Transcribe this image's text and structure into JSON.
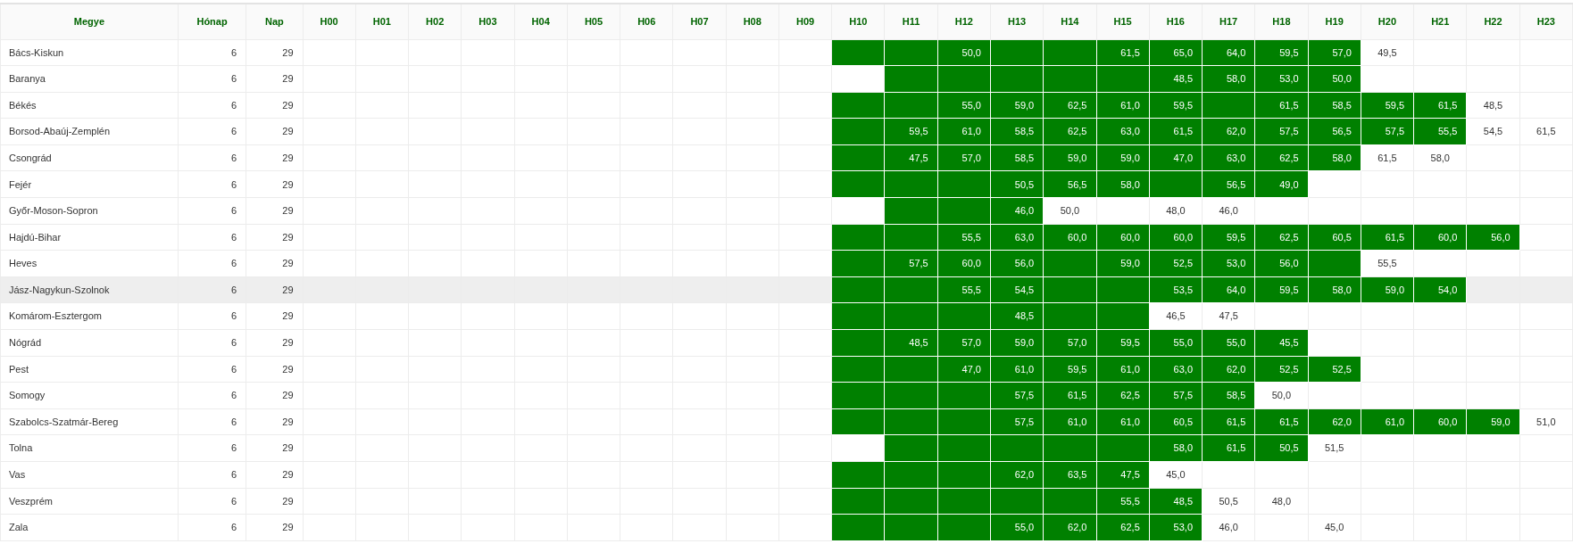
{
  "table": {
    "columns": [
      "Megye",
      "Hónap",
      "Nap",
      "H00",
      "H01",
      "H02",
      "H03",
      "H04",
      "H05",
      "H06",
      "H07",
      "H08",
      "H09",
      "H10",
      "H11",
      "H12",
      "H13",
      "H14",
      "H15",
      "H16",
      "H17",
      "H18",
      "H19",
      "H20",
      "H21",
      "H22",
      "H23"
    ],
    "rows": [
      {
        "county": "Bács-Kiskun",
        "month": "6",
        "day": "29",
        "hovered": false,
        "cells": [
          {
            "highlighted": true
          },
          {
            "highlighted": true
          },
          {
            "value": "50,0",
            "highlighted": true
          },
          {
            "highlighted": true
          },
          {
            "highlighted": true
          },
          {
            "value": "61,5",
            "highlighted": true
          },
          {
            "value": "65,0",
            "highlighted": true
          },
          {
            "value": "64,0",
            "highlighted": true
          },
          {
            "value": "59,5",
            "highlighted": true
          },
          {
            "value": "57,0",
            "highlighted": true
          },
          {
            "value": "49,5",
            "highlighted": false
          },
          {
            "highlighted": false
          },
          {
            "highlighted": false
          },
          {
            "highlighted": false
          }
        ]
      },
      {
        "county": "Baranya",
        "month": "6",
        "day": "29",
        "hovered": false,
        "cells": [
          {
            "highlighted": false
          },
          {
            "highlighted": true
          },
          {
            "highlighted": true
          },
          {
            "highlighted": true
          },
          {
            "highlighted": true
          },
          {
            "highlighted": true
          },
          {
            "value": "48,5",
            "highlighted": true
          },
          {
            "value": "58,0",
            "highlighted": true
          },
          {
            "value": "53,0",
            "highlighted": true
          },
          {
            "value": "50,0",
            "highlighted": true
          },
          {
            "highlighted": false
          },
          {
            "highlighted": false
          },
          {
            "highlighted": false
          },
          {
            "highlighted": false
          }
        ]
      },
      {
        "county": "Békés",
        "month": "6",
        "day": "29",
        "hovered": false,
        "cells": [
          {
            "highlighted": true
          },
          {
            "highlighted": true
          },
          {
            "value": "55,0",
            "highlighted": true
          },
          {
            "value": "59,0",
            "highlighted": true
          },
          {
            "value": "62,5",
            "highlighted": true
          },
          {
            "value": "61,0",
            "highlighted": true
          },
          {
            "value": "59,5",
            "highlighted": true
          },
          {
            "highlighted": true
          },
          {
            "value": "61,5",
            "highlighted": true
          },
          {
            "value": "58,5",
            "highlighted": true
          },
          {
            "value": "59,5",
            "highlighted": true
          },
          {
            "value": "61,5",
            "highlighted": true
          },
          {
            "value": "48,5",
            "highlighted": false
          },
          {
            "highlighted": false
          }
        ]
      },
      {
        "county": "Borsod-Abaúj-Zemplén",
        "month": "6",
        "day": "29",
        "hovered": false,
        "cells": [
          {
            "highlighted": true
          },
          {
            "value": "59,5",
            "highlighted": true
          },
          {
            "value": "61,0",
            "highlighted": true
          },
          {
            "value": "58,5",
            "highlighted": true
          },
          {
            "value": "62,5",
            "highlighted": true
          },
          {
            "value": "63,0",
            "highlighted": true
          },
          {
            "value": "61,5",
            "highlighted": true
          },
          {
            "value": "62,0",
            "highlighted": true
          },
          {
            "value": "57,5",
            "highlighted": true
          },
          {
            "value": "56,5",
            "highlighted": true
          },
          {
            "value": "57,5",
            "highlighted": true
          },
          {
            "value": "55,5",
            "highlighted": true
          },
          {
            "value": "54,5",
            "highlighted": false
          },
          {
            "value": "61,5",
            "highlighted": false
          }
        ]
      },
      {
        "county": "Csongrád",
        "month": "6",
        "day": "29",
        "hovered": false,
        "cells": [
          {
            "highlighted": true
          },
          {
            "value": "47,5",
            "highlighted": true
          },
          {
            "value": "57,0",
            "highlighted": true
          },
          {
            "value": "58,5",
            "highlighted": true
          },
          {
            "value": "59,0",
            "highlighted": true
          },
          {
            "value": "59,0",
            "highlighted": true
          },
          {
            "value": "47,0",
            "highlighted": true
          },
          {
            "value": "63,0",
            "highlighted": true
          },
          {
            "value": "62,5",
            "highlighted": true
          },
          {
            "value": "58,0",
            "highlighted": true
          },
          {
            "value": "61,5",
            "highlighted": false
          },
          {
            "value": "58,0",
            "highlighted": false
          },
          {
            "highlighted": false
          },
          {
            "highlighted": false
          }
        ]
      },
      {
        "county": "Fejér",
        "month": "6",
        "day": "29",
        "hovered": false,
        "cells": [
          {
            "highlighted": true
          },
          {
            "highlighted": true
          },
          {
            "highlighted": true
          },
          {
            "value": "50,5",
            "highlighted": true
          },
          {
            "value": "56,5",
            "highlighted": true
          },
          {
            "value": "58,0",
            "highlighted": true
          },
          {
            "highlighted": true
          },
          {
            "value": "56,5",
            "highlighted": true
          },
          {
            "value": "49,0",
            "highlighted": true
          },
          {
            "highlighted": false
          },
          {
            "highlighted": false
          },
          {
            "highlighted": false
          },
          {
            "highlighted": false
          },
          {
            "highlighted": false
          }
        ]
      },
      {
        "county": "Győr-Moson-Sopron",
        "month": "6",
        "day": "29",
        "hovered": false,
        "cells": [
          {
            "highlighted": false
          },
          {
            "highlighted": true
          },
          {
            "highlighted": true
          },
          {
            "value": "46,0",
            "highlighted": true
          },
          {
            "value": "50,0",
            "highlighted": false
          },
          {
            "highlighted": false
          },
          {
            "value": "48,0",
            "highlighted": false
          },
          {
            "value": "46,0",
            "highlighted": false
          },
          {
            "highlighted": false
          },
          {
            "highlighted": false
          },
          {
            "highlighted": false
          },
          {
            "highlighted": false
          },
          {
            "highlighted": false
          },
          {
            "highlighted": false
          }
        ]
      },
      {
        "county": "Hajdú-Bihar",
        "month": "6",
        "day": "29",
        "hovered": false,
        "cells": [
          {
            "highlighted": true
          },
          {
            "highlighted": true
          },
          {
            "value": "55,5",
            "highlighted": true
          },
          {
            "value": "63,0",
            "highlighted": true
          },
          {
            "value": "60,0",
            "highlighted": true
          },
          {
            "value": "60,0",
            "highlighted": true
          },
          {
            "value": "60,0",
            "highlighted": true
          },
          {
            "value": "59,5",
            "highlighted": true
          },
          {
            "value": "62,5",
            "highlighted": true
          },
          {
            "value": "60,5",
            "highlighted": true
          },
          {
            "value": "61,5",
            "highlighted": true
          },
          {
            "value": "60,0",
            "highlighted": true
          },
          {
            "value": "56,0",
            "highlighted": true
          },
          {
            "highlighted": false
          }
        ]
      },
      {
        "county": "Heves",
        "month": "6",
        "day": "29",
        "hovered": false,
        "cells": [
          {
            "highlighted": true
          },
          {
            "value": "57,5",
            "highlighted": true
          },
          {
            "value": "60,0",
            "highlighted": true
          },
          {
            "value": "56,0",
            "highlighted": true
          },
          {
            "highlighted": true
          },
          {
            "value": "59,0",
            "highlighted": true
          },
          {
            "value": "52,5",
            "highlighted": true
          },
          {
            "value": "53,0",
            "highlighted": true
          },
          {
            "value": "56,0",
            "highlighted": true
          },
          {
            "highlighted": true
          },
          {
            "value": "55,5",
            "highlighted": false
          },
          {
            "highlighted": false
          },
          {
            "highlighted": false
          },
          {
            "highlighted": false
          }
        ]
      },
      {
        "county": "Jász-Nagykun-Szolnok",
        "month": "6",
        "day": "29",
        "hovered": true,
        "cells": [
          {
            "highlighted": true
          },
          {
            "highlighted": true
          },
          {
            "value": "55,5",
            "highlighted": true
          },
          {
            "value": "54,5",
            "highlighted": true
          },
          {
            "highlighted": true
          },
          {
            "highlighted": true
          },
          {
            "value": "53,5",
            "highlighted": true
          },
          {
            "value": "64,0",
            "highlighted": true
          },
          {
            "value": "59,5",
            "highlighted": true
          },
          {
            "value": "58,0",
            "highlighted": true
          },
          {
            "value": "59,0",
            "highlighted": true
          },
          {
            "value": "54,0",
            "highlighted": true
          },
          {
            "highlighted": false
          },
          {
            "highlighted": false
          }
        ]
      },
      {
        "county": "Komárom-Esztergom",
        "month": "6",
        "day": "29",
        "hovered": false,
        "cells": [
          {
            "highlighted": true
          },
          {
            "highlighted": true
          },
          {
            "highlighted": true
          },
          {
            "value": "48,5",
            "highlighted": true
          },
          {
            "highlighted": true
          },
          {
            "highlighted": true
          },
          {
            "value": "46,5",
            "highlighted": false
          },
          {
            "value": "47,5",
            "highlighted": false
          },
          {
            "highlighted": false
          },
          {
            "highlighted": false
          },
          {
            "highlighted": false
          },
          {
            "highlighted": false
          },
          {
            "highlighted": false
          },
          {
            "highlighted": false
          }
        ]
      },
      {
        "county": "Nógrád",
        "month": "6",
        "day": "29",
        "hovered": false,
        "cells": [
          {
            "highlighted": true
          },
          {
            "value": "48,5",
            "highlighted": true
          },
          {
            "value": "57,0",
            "highlighted": true
          },
          {
            "value": "59,0",
            "highlighted": true
          },
          {
            "value": "57,0",
            "highlighted": true
          },
          {
            "value": "59,5",
            "highlighted": true
          },
          {
            "value": "55,0",
            "highlighted": true
          },
          {
            "value": "55,0",
            "highlighted": true
          },
          {
            "value": "45,5",
            "highlighted": true
          },
          {
            "highlighted": false
          },
          {
            "highlighted": false
          },
          {
            "highlighted": false
          },
          {
            "highlighted": false
          },
          {
            "highlighted": false
          }
        ]
      },
      {
        "county": "Pest",
        "month": "6",
        "day": "29",
        "hovered": false,
        "cells": [
          {
            "highlighted": true
          },
          {
            "highlighted": true
          },
          {
            "value": "47,0",
            "highlighted": true
          },
          {
            "value": "61,0",
            "highlighted": true
          },
          {
            "value": "59,5",
            "highlighted": true
          },
          {
            "value": "61,0",
            "highlighted": true
          },
          {
            "value": "63,0",
            "highlighted": true
          },
          {
            "value": "62,0",
            "highlighted": true
          },
          {
            "value": "52,5",
            "highlighted": true
          },
          {
            "value": "52,5",
            "highlighted": true
          },
          {
            "highlighted": false
          },
          {
            "highlighted": false
          },
          {
            "highlighted": false
          },
          {
            "highlighted": false
          }
        ]
      },
      {
        "county": "Somogy",
        "month": "6",
        "day": "29",
        "hovered": false,
        "cells": [
          {
            "highlighted": true
          },
          {
            "highlighted": true
          },
          {
            "highlighted": true
          },
          {
            "value": "57,5",
            "highlighted": true
          },
          {
            "value": "61,5",
            "highlighted": true
          },
          {
            "value": "62,5",
            "highlighted": true
          },
          {
            "value": "57,5",
            "highlighted": true
          },
          {
            "value": "58,5",
            "highlighted": true
          },
          {
            "value": "50,0",
            "highlighted": false
          },
          {
            "highlighted": false
          },
          {
            "highlighted": false
          },
          {
            "highlighted": false
          },
          {
            "highlighted": false
          },
          {
            "highlighted": false
          }
        ]
      },
      {
        "county": "Szabolcs-Szatmár-Bereg",
        "month": "6",
        "day": "29",
        "hovered": false,
        "cells": [
          {
            "highlighted": true
          },
          {
            "highlighted": true
          },
          {
            "highlighted": true
          },
          {
            "value": "57,5",
            "highlighted": true
          },
          {
            "value": "61,0",
            "highlighted": true
          },
          {
            "value": "61,0",
            "highlighted": true
          },
          {
            "value": "60,5",
            "highlighted": true
          },
          {
            "value": "61,5",
            "highlighted": true
          },
          {
            "value": "61,5",
            "highlighted": true
          },
          {
            "value": "62,0",
            "highlighted": true
          },
          {
            "value": "61,0",
            "highlighted": true
          },
          {
            "value": "60,0",
            "highlighted": true
          },
          {
            "value": "59,0",
            "highlighted": true
          },
          {
            "value": "51,0",
            "highlighted": false
          }
        ]
      },
      {
        "county": "Tolna",
        "month": "6",
        "day": "29",
        "hovered": false,
        "cells": [
          {
            "highlighted": false
          },
          {
            "highlighted": true
          },
          {
            "highlighted": true
          },
          {
            "highlighted": true
          },
          {
            "highlighted": true
          },
          {
            "highlighted": true
          },
          {
            "value": "58,0",
            "highlighted": true
          },
          {
            "value": "61,5",
            "highlighted": true
          },
          {
            "value": "50,5",
            "highlighted": true
          },
          {
            "value": "51,5",
            "highlighted": false
          },
          {
            "highlighted": false
          },
          {
            "highlighted": false
          },
          {
            "highlighted": false
          },
          {
            "highlighted": false
          }
        ]
      },
      {
        "county": "Vas",
        "month": "6",
        "day": "29",
        "hovered": false,
        "cells": [
          {
            "highlighted": true
          },
          {
            "highlighted": true
          },
          {
            "highlighted": true
          },
          {
            "value": "62,0",
            "highlighted": true
          },
          {
            "value": "63,5",
            "highlighted": true
          },
          {
            "value": "47,5",
            "highlighted": true
          },
          {
            "value": "45,0",
            "highlighted": false
          },
          {
            "highlighted": false
          },
          {
            "highlighted": false
          },
          {
            "highlighted": false
          },
          {
            "highlighted": false
          },
          {
            "highlighted": false
          },
          {
            "highlighted": false
          },
          {
            "highlighted": false
          }
        ]
      },
      {
        "county": "Veszprém",
        "month": "6",
        "day": "29",
        "hovered": false,
        "cells": [
          {
            "highlighted": true
          },
          {
            "highlighted": true
          },
          {
            "highlighted": true
          },
          {
            "highlighted": true
          },
          {
            "highlighted": true
          },
          {
            "value": "55,5",
            "highlighted": true
          },
          {
            "value": "48,5",
            "highlighted": true
          },
          {
            "value": "50,5",
            "highlighted": false
          },
          {
            "value": "48,0",
            "highlighted": false
          },
          {
            "highlighted": false
          },
          {
            "highlighted": false
          },
          {
            "highlighted": false
          },
          {
            "highlighted": false
          },
          {
            "highlighted": false
          }
        ]
      },
      {
        "county": "Zala",
        "month": "6",
        "day": "29",
        "hovered": false,
        "cells": [
          {
            "highlighted": true
          },
          {
            "highlighted": true
          },
          {
            "highlighted": true
          },
          {
            "value": "55,0",
            "highlighted": true
          },
          {
            "value": "62,0",
            "highlighted": true
          },
          {
            "value": "62,5",
            "highlighted": true
          },
          {
            "value": "53,0",
            "highlighted": true
          },
          {
            "value": "46,0",
            "highlighted": false
          },
          {
            "highlighted": false
          },
          {
            "value": "45,0",
            "highlighted": false
          },
          {
            "highlighted": false
          },
          {
            "highlighted": false
          },
          {
            "highlighted": false
          },
          {
            "highlighted": false
          }
        ]
      }
    ]
  }
}
